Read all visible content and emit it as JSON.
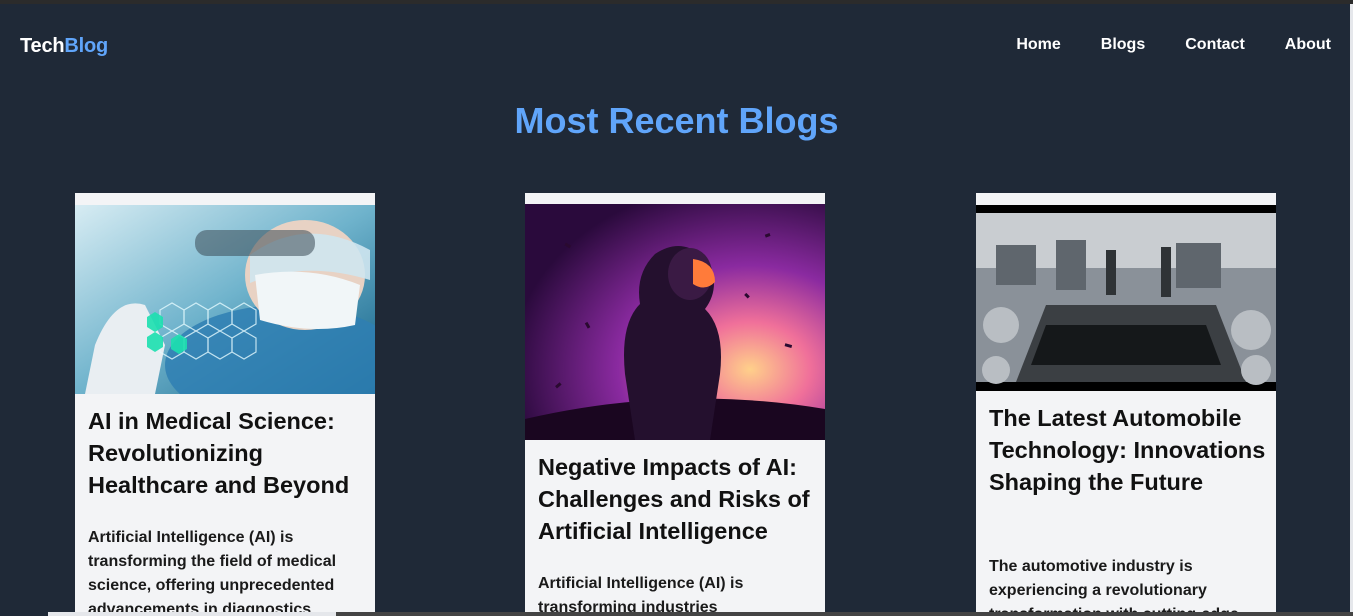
{
  "brand": {
    "part1": "Tech",
    "part2": "Blog"
  },
  "nav": {
    "home": "Home",
    "blogs": "Blogs",
    "contact": "Contact",
    "about": "About"
  },
  "page": {
    "heading": "Most Recent Blogs"
  },
  "cards": [
    {
      "title": "AI in Medical Science: Revolutionizing Healthcare and Beyond",
      "excerpt": "Artificial Intelligence (AI) is transforming the field of medical science, offering unprecedented advancements in diagnostics"
    },
    {
      "title": "Negative Impacts of AI: Challenges and Risks of Artificial Intelligence",
      "excerpt": "Artificial Intelligence (AI) is transforming industries"
    },
    {
      "title": "The Latest Automobile Technology: Innovations Shaping the Future",
      "excerpt": "The automotive industry is experiencing a revolutionary transformation with cutting-edge"
    }
  ],
  "colors": {
    "background": "#1f2937",
    "accent": "#60a5fa",
    "card": "#f3f4f6"
  }
}
